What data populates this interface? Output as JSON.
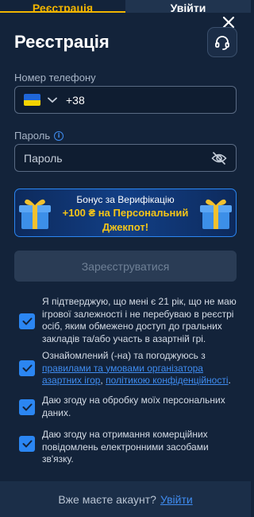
{
  "tabs": [
    {
      "label": "Реєстрація",
      "active": true
    },
    {
      "label": "Увійти",
      "active": false
    }
  ],
  "form": {
    "title": "Реєстрація",
    "phone_label": "Номер телефону",
    "phone_prefix": "+38",
    "password_label": "Пароль",
    "password_placeholder": "Пароль",
    "submit_label": "Зареєструватися"
  },
  "banner": {
    "line1": "Бонус за Верифікацію",
    "line2": "+100 ₴ на Персональний",
    "line3": "Джекпот!"
  },
  "consents": [
    {
      "text": "Я підтверджую, що мені є 21 рік, що не маю ігрової залежності і не перебуваю в реєстрі осіб, яким обмежено доступ до гральних закладів та/або участь в азартній грі.",
      "checked": true
    },
    {
      "text_before": "Ознайомлений (-на) та погоджуюсь з ",
      "link1": "правилами та умовами організатора азартних ігор",
      "between": ", ",
      "link2": "політикою конфіденційності",
      "after": ".",
      "checked": true
    },
    {
      "text": "Даю згоду на обробку моїх персональних даних.",
      "checked": true
    },
    {
      "text": "Даю згоду на отримання комерційних повідомлень електронними засобами зв'язку.",
      "checked": true
    }
  ],
  "footer": {
    "question": "Вже маєте акаунт?",
    "login_link": "Увійти"
  },
  "icons": {
    "close": "close-icon",
    "support": "headset-icon",
    "info": "info-icon",
    "flag": "ukraine-flag-icon",
    "chevron": "chevron-down-icon",
    "eye": "eye-off-icon",
    "gift": "gift-box-icon",
    "check": "checkmark-icon"
  },
  "colors": {
    "background": "#13233a",
    "accent": "#2b86f2",
    "tab_active": "#f0b400",
    "bonus_text": "#f5c518"
  }
}
